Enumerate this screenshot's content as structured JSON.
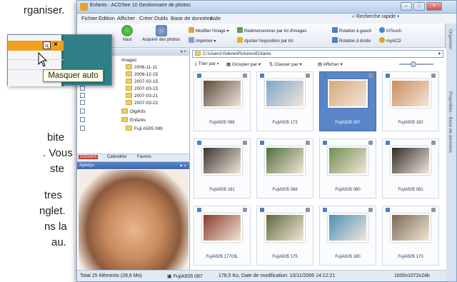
{
  "doc": {
    "lines": [
      "rganiser.",
      "bite",
      ". Vous",
      "ste",
      "tres",
      "nglet.",
      "ns la",
      "au."
    ]
  },
  "window": {
    "title": "Enfants - ACDSee 10 Gestionnaire de photos",
    "menu": [
      "Fichier",
      "Edition",
      "Afficher",
      "Créer",
      "Outils",
      "Base de données",
      "Aide"
    ],
    "quick_search": "Recherche rapide"
  },
  "toolbar": {
    "haut": "Haut",
    "acquire": "Acquérir des photos",
    "modify": "Modifier l'image",
    "print": "Imprimer",
    "batch_resize": "Redimensionner par lot d'images",
    "batch_exposure": "Ajuster l'exposition par lot",
    "rotate_left": "Rotation à gauch",
    "rotate_right": "Rotation à droite",
    "intouch": "InTouch",
    "myacd": "myACD"
  },
  "side_tabs": [
    "Organiser",
    "Propriétés - Base de données"
  ],
  "folders": {
    "items": [
      "Images",
      "2006-11-11",
      "2006-12-15",
      "2007-02-15",
      "2007-03-15",
      "2007-03-21",
      "2007-03-22",
      "DigiKits",
      "Enfants",
      "Fuji A505 089"
    ],
    "tabs": [
      "Dossiers",
      "Calendrier",
      "Favoris"
    ]
  },
  "preview": {
    "title": "Aperçu"
  },
  "browser": {
    "path": "C:\\Users\\Yolene\\Pictures\\Enfants",
    "sort": "Trier par",
    "group": "Grouper par",
    "classify": "Classer par",
    "view": "Afficher",
    "thumbnails": [
      {
        "name": "FujiA505 086",
        "selected": false,
        "color": "#5a4a3c"
      },
      {
        "name": "FujiA505 173",
        "selected": false,
        "color": "#7ea6c8"
      },
      {
        "name": "FujiA505 087",
        "selected": true,
        "color": "#d6a77a"
      },
      {
        "name": "FujiA505 182",
        "selected": false,
        "color": "#c98c5c"
      },
      {
        "name": "FujiA505 181",
        "selected": false,
        "color": "#3a3530"
      },
      {
        "name": "FujiA505 088",
        "selected": false,
        "color": "#4f6e3c"
      },
      {
        "name": "FujiA505 080",
        "selected": false,
        "color": "#6f8e52"
      },
      {
        "name": "FujiA505 081",
        "selected": false,
        "color": "#2c2a28"
      },
      {
        "name": "FujiA505 177OIL",
        "selected": false,
        "color": "#8a3b2a"
      },
      {
        "name": "FujiA505 175",
        "selected": false,
        "color": "#5d6a3e"
      },
      {
        "name": "FujiA505 180",
        "selected": false,
        "color": "#4a8fb8"
      },
      {
        "name": "FujiA505 170",
        "selected": false,
        "color": "#7a6a52"
      }
    ]
  },
  "status": {
    "total": "Total 25 éléments (28,6 Mo)",
    "file": "FujiA505 087",
    "details": "178,5 Ko, Date de modification: 10/11/2006 14:12:21",
    "dims": "1600x1072x24b"
  },
  "callout": {
    "pin_glyph": "ц",
    "close_glyph": "×",
    "tooltip": "Masquer auto"
  },
  "colors": {
    "accent": "#f0a020",
    "selection": "#5a86c7",
    "teal": "#2f7f86"
  }
}
